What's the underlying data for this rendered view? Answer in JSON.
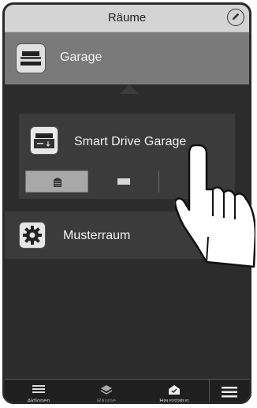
{
  "header": {
    "title": "Räume",
    "edit_icon": "pencil-icon"
  },
  "rooms": [
    {
      "label": "Garage",
      "icon": "garage-icon"
    },
    {
      "label": "Musterraum",
      "icon": "gear-icon"
    }
  ],
  "device": {
    "label": "Smart Drive Garage",
    "icon": "garage-door-icon",
    "positions": [
      {
        "icon": "closed-door-icon",
        "selected": true
      },
      {
        "icon": "open-door-icon",
        "selected": false
      },
      {
        "icon": "partial-door-icon",
        "selected": false
      }
    ]
  },
  "bottom_nav": [
    {
      "label": "Aktionen",
      "icon": "list-icon"
    },
    {
      "label": "Räume",
      "icon": "layers-icon"
    },
    {
      "label": "Hausstatus",
      "icon": "house-check-icon"
    }
  ],
  "menu_icon": "hamburger-menu-icon",
  "colors": {
    "header_bg": "#d4d4d4",
    "selected_room": "#7a7a7a",
    "panel": "#3b3b3b",
    "screen": "#2c2c2c",
    "nav": "#1f1f1f"
  }
}
